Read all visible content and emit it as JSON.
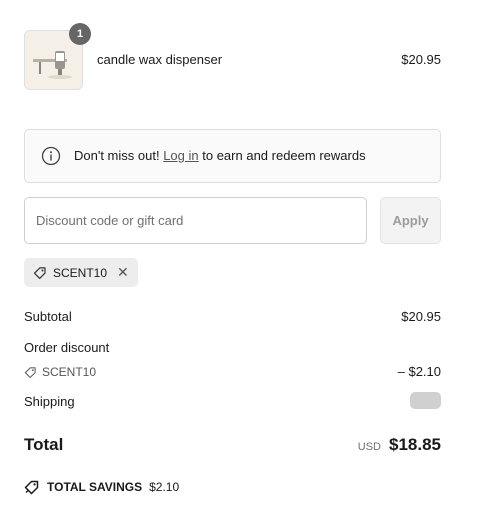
{
  "line_item": {
    "quantity": "1",
    "name": "candle wax dispenser",
    "price": "$20.95",
    "image_icon": "candle-wax-dispenser-image"
  },
  "notice": {
    "icon": "info-icon",
    "prefix": "Don't miss out!",
    "link": "Log in",
    "suffix": "to earn and redeem rewards"
  },
  "discount": {
    "placeholder": "Discount code or gift card",
    "value": "",
    "apply_label": "Apply",
    "applied_code": "SCENT10",
    "remove_glyph": "✕"
  },
  "summary": {
    "subtotal_label": "Subtotal",
    "subtotal_value": "$20.95",
    "order_discount_label": "Order discount",
    "discount_code": "SCENT10",
    "discount_value": "– $2.10",
    "shipping_label": "Shipping",
    "total_label": "Total",
    "currency": "USD",
    "total_value": "$18.85",
    "savings_label": "TOTAL SAVINGS",
    "savings_value": "$2.10"
  },
  "colors": {
    "accent_badge": "#666666",
    "chip_bg": "#ededed",
    "shipping_placeholder": "#d0d0d0"
  }
}
